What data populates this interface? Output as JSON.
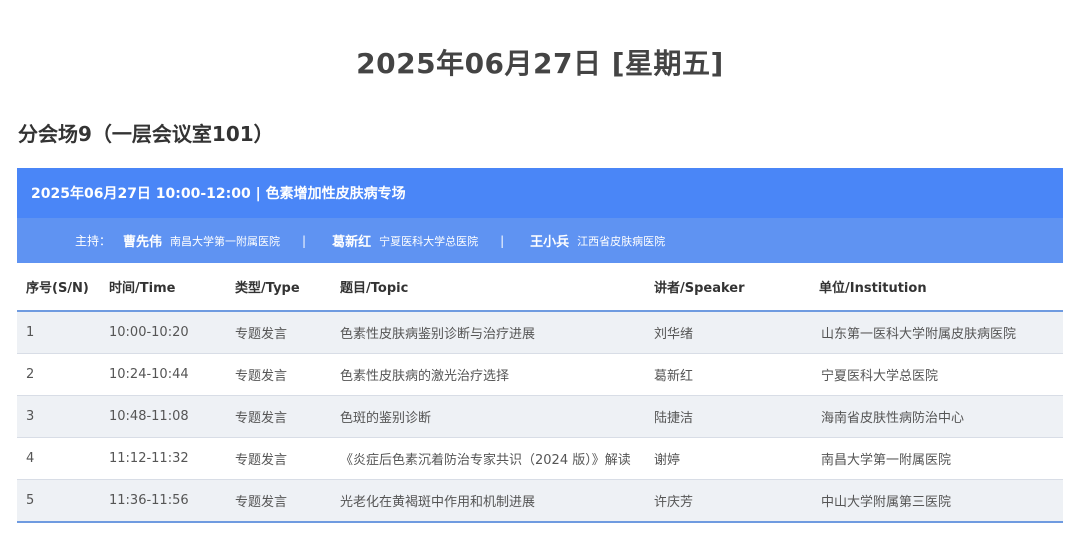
{
  "page": {
    "date_title": "2025年06月27日 [星期五]",
    "venue_title": "分会场9（一层会议室101）"
  },
  "session": {
    "header": "2025年06月27日 10:00-12:00 | 色素增加性皮肤病专场",
    "chair_label": "主持：",
    "chairs": [
      {
        "name": "曹先伟",
        "institution": "南昌大学第一附属医院"
      },
      {
        "name": "葛新红",
        "institution": "宁夏医科大学总医院"
      },
      {
        "name": "王小兵",
        "institution": "江西省皮肤病医院"
      }
    ],
    "separator": "|"
  },
  "table": {
    "headers": {
      "sn": "序号(S/N)",
      "time": "时间/Time",
      "type": "类型/Type",
      "topic": "题目/Topic",
      "speaker": "讲者/Speaker",
      "institution": "单位/Institution"
    },
    "rows": [
      {
        "sn": "1",
        "time": "10:00-10:20",
        "type": "专题发言",
        "topic": "色素性皮肤病鉴别诊断与治疗进展",
        "speaker": "刘华绪",
        "institution": "山东第一医科大学附属皮肤病医院"
      },
      {
        "sn": "2",
        "time": "10:24-10:44",
        "type": "专题发言",
        "topic": "色素性皮肤病的激光治疗选择",
        "speaker": "葛新红",
        "institution": "宁夏医科大学总医院"
      },
      {
        "sn": "3",
        "time": "10:48-11:08",
        "type": "专题发言",
        "topic": "色斑的鉴别诊断",
        "speaker": "陆捷洁",
        "institution": "海南省皮肤性病防治中心"
      },
      {
        "sn": "4",
        "time": "11:12-11:32",
        "type": "专题发言",
        "topic": "《炎症后色素沉着防治专家共识（2024 版）》解读",
        "speaker": "谢婷",
        "institution": "南昌大学第一附属医院"
      },
      {
        "sn": "5",
        "time": "11:36-11:56",
        "type": "专题发言",
        "topic": "光老化在黄褐斑中作用和机制进展",
        "speaker": "许庆芳",
        "institution": "中山大学附属第三医院"
      }
    ]
  },
  "colors": {
    "session_header_bg": "#4a86f7",
    "chair_bar_bg": "#5f93f2",
    "row_stripe": "#eef1f5",
    "rule_blue": "#6f9be0"
  }
}
